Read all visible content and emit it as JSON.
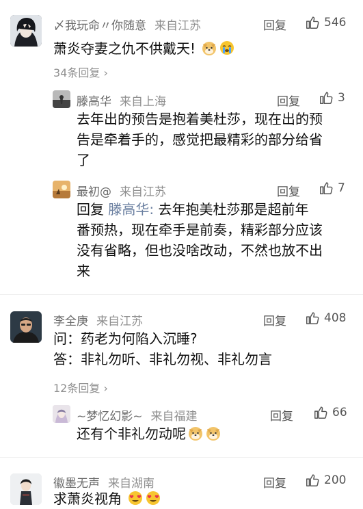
{
  "reply_label": "回复",
  "comments": [
    {
      "username": "〆我玩命〃你随意",
      "location": "来自江苏",
      "likes": "546",
      "text": "萧炎夺妻之仇不供戴天!",
      "more": "34条回复",
      "replies": [
        {
          "username": "滕高华",
          "location": "来自上海",
          "likes": "3",
          "lines": [
            "去年出的预告是抱着美杜莎，现在出的预",
            "告是牵着手的，感觉把最精彩的部分给省",
            "了"
          ]
        },
        {
          "username": "最初@",
          "location": "来自江苏",
          "likes": "7",
          "reply_prefix": "回复",
          "reply_to": "滕高华:",
          "lines": [
            "去年抱美杜莎那是超前年",
            "番预热，现在牵手是前奏，精彩部分应该",
            "没有省略，但也没啥改动，不然也放不出",
            "来"
          ]
        }
      ]
    },
    {
      "username": "李全庚",
      "location": "来自江苏",
      "likes": "408",
      "lines": [
        "问：药老为何陷入沉睡?",
        "答：非礼勿听、非礼勿视、非礼勿言"
      ],
      "more": "12条回复",
      "replies": [
        {
          "username": "~梦忆幻影~",
          "location": "来自福建",
          "likes": "66",
          "text": "还有个非礼勿动呢"
        }
      ]
    },
    {
      "username": "徽墨无声",
      "location": "来自湖南",
      "likes": "200",
      "text": "求萧炎视角"
    }
  ]
}
